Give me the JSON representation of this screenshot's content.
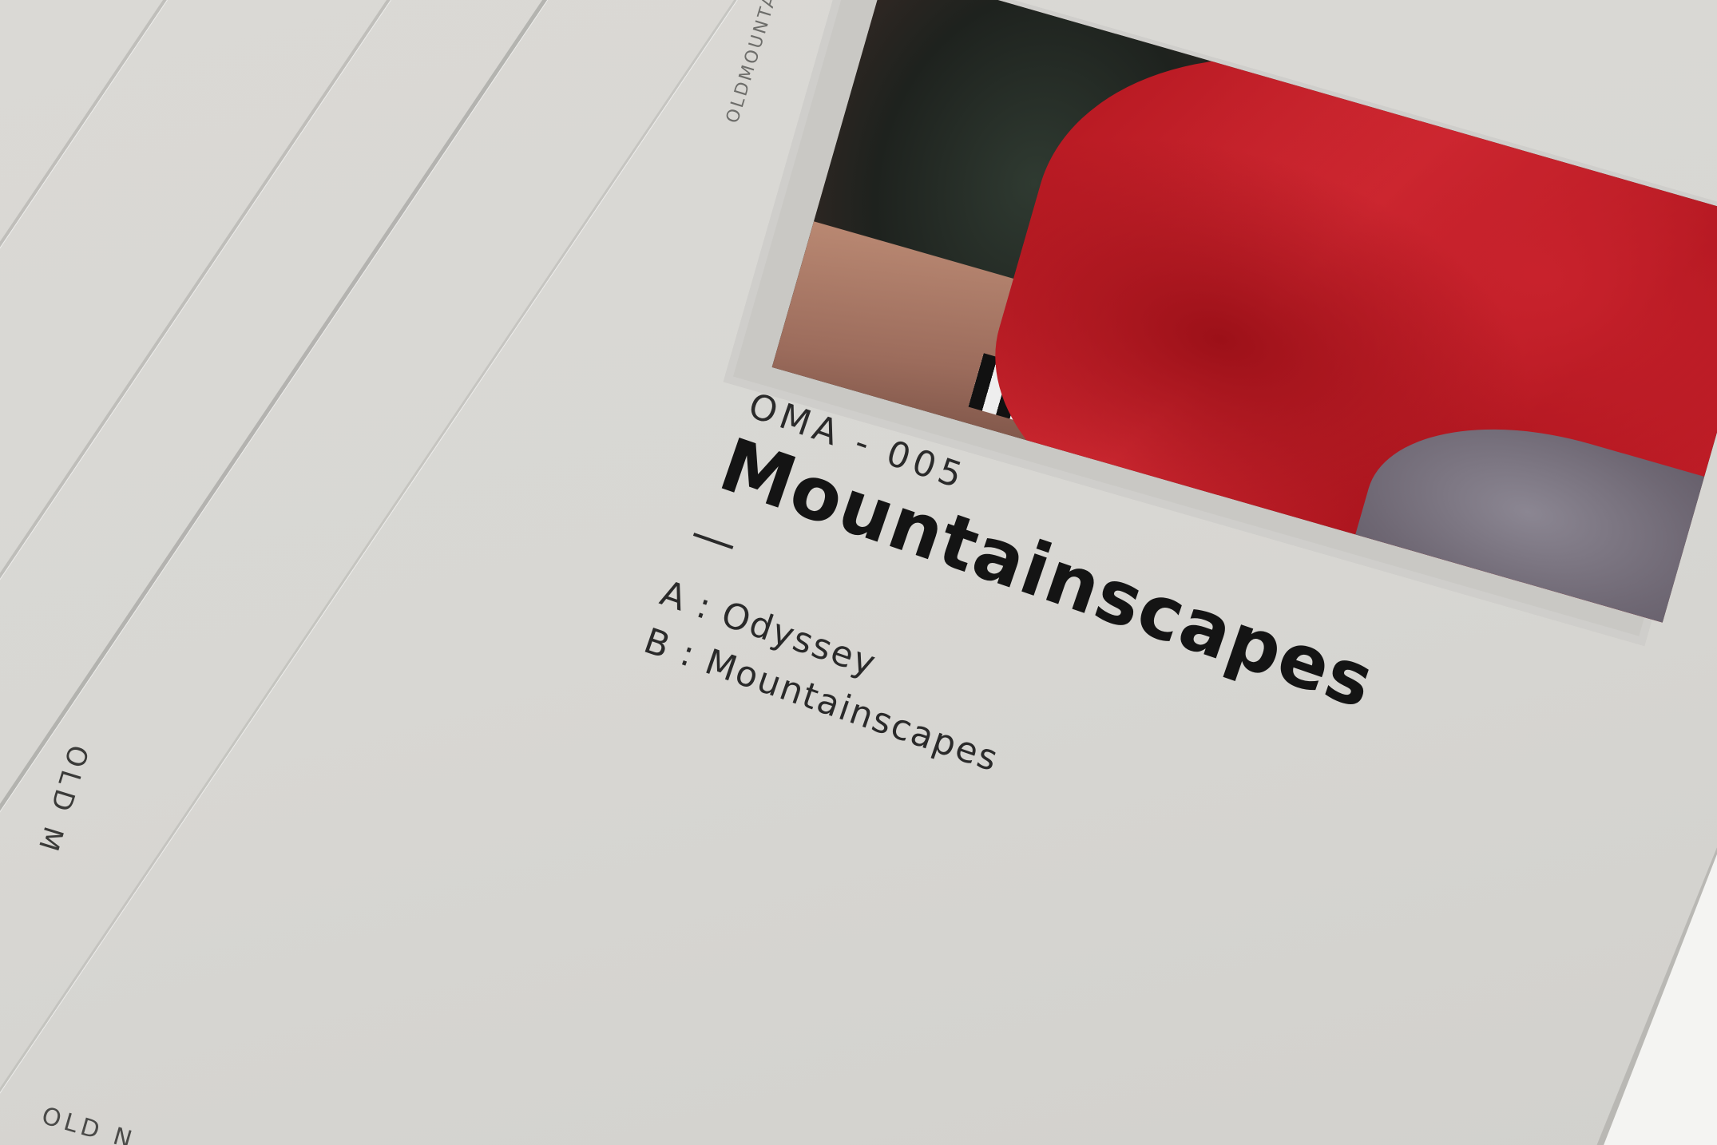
{
  "sleeve": {
    "catalog_number": "OMA - 005",
    "title": "Mountainscapes",
    "dash": "—",
    "tracks": [
      {
        "side": "A",
        "name": "A : Odyssey"
      },
      {
        "side": "B",
        "name": "B : Mountainscapes"
      }
    ],
    "spine_left_text": "OLD M",
    "spine_bottom_text": "OLD N",
    "spine_top_text": "OLDMOUNTAIN"
  },
  "colors": {
    "card": "#d8d7d3",
    "text": "#141414",
    "photo_red": "#c8222c"
  }
}
